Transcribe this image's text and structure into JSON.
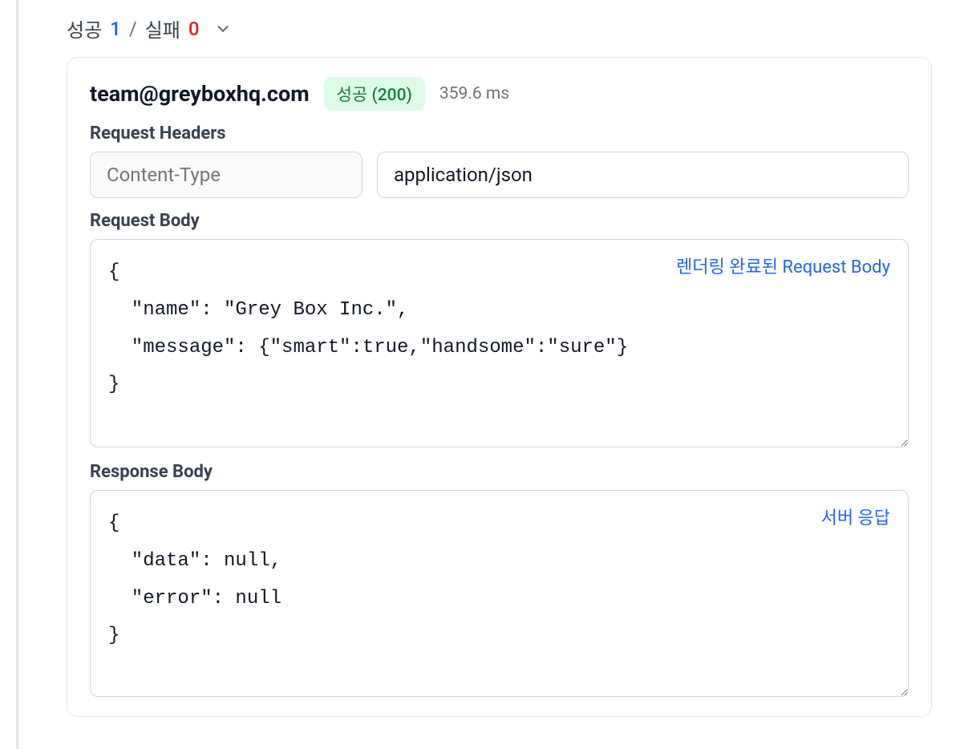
{
  "summary": {
    "success_label": "성공",
    "success_count": "1",
    "separator": "/",
    "fail_label": "실패",
    "fail_count": "0"
  },
  "request": {
    "email": "team@greyboxhq.com",
    "status_badge": "성공 (200)",
    "timing": "359.6 ms",
    "headers_label": "Request Headers",
    "header_key_placeholder": "Content-Type",
    "header_value": "application/json",
    "request_body_label": "Request Body",
    "request_body_link": "렌더링 완료된 Request Body",
    "request_body_content": "{\n  \"name\": \"Grey Box Inc.\",\n  \"message\": {\"smart\":true,\"handsome\":\"sure\"}\n}",
    "response_body_label": "Response Body",
    "response_body_link": "서버 응답",
    "response_body_content": "{\n  \"data\": null,\n  \"error\": null\n}"
  }
}
